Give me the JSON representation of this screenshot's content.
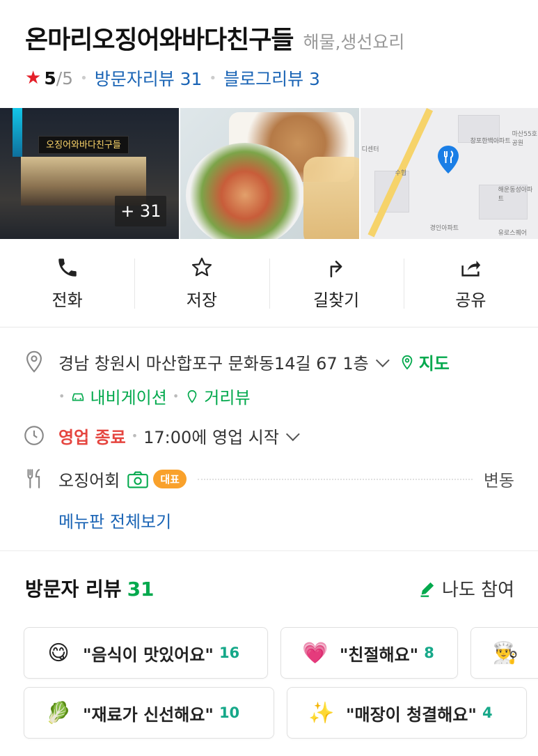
{
  "header": {
    "title": "온마리오징어와바다친구들",
    "category": "해물,생선요리",
    "rating_score": "5",
    "rating_total": "/5",
    "visitor_reviews": "방문자리뷰 31",
    "blog_reviews": "블로그리뷰 3"
  },
  "photos": {
    "more_count": "+ 31",
    "sign_text": "오징어와바다친구들",
    "map_labels": [
      "디센터",
      "창포한백아파트",
      "마산55호공원",
      "수협",
      "해운동성아파트",
      "경인아파트",
      "유로스퀘어"
    ]
  },
  "actions": [
    {
      "label": "전화",
      "icon": "phone-icon"
    },
    {
      "label": "저장",
      "icon": "star-outline-icon"
    },
    {
      "label": "길찾기",
      "icon": "directions-arrow-icon"
    },
    {
      "label": "공유",
      "icon": "share-icon"
    }
  ],
  "info": {
    "address": "경남 창원시 마산합포구 문화동14길 67 1층",
    "map_link": "지도",
    "navigation_link": "내비게이션",
    "street_view_link": "거리뷰",
    "status": "영업 종료",
    "hours_text": "17:00에 영업 시작",
    "menu_item": "오징어회",
    "menu_badge": "대표",
    "menu_price": "변동",
    "menu_all_link": "메뉴판 전체보기"
  },
  "reviews": {
    "title": "방문자 리뷰",
    "count": "31",
    "participate": "나도 참여",
    "chips": [
      {
        "text": "\"음식이 맛있어요\"",
        "count": "16",
        "emoji": "😋"
      },
      {
        "text": "\"친절해요\"",
        "count": "8",
        "emoji": "💗"
      },
      {
        "text": "",
        "count": "",
        "emoji": "👨‍🍳"
      },
      {
        "text": "\"재료가 신선해요\"",
        "count": "10",
        "emoji": "🥬"
      },
      {
        "text": "\"매장이 청결해요\"",
        "count": "4",
        "emoji": "✨"
      }
    ]
  },
  "colors": {
    "link_blue": "#1a64b5",
    "accent_green": "#03a94d",
    "closed_red": "#e5453f",
    "star_red": "#e4202a",
    "badge_orange": "#f9a12b",
    "count_teal": "#16a889"
  }
}
